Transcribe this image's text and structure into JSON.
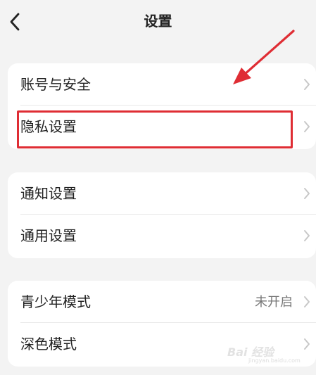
{
  "header": {
    "title": "设置"
  },
  "sections": [
    {
      "items": [
        {
          "label": "账号与安全"
        },
        {
          "label": "隐私设置"
        }
      ]
    },
    {
      "items": [
        {
          "label": "通知设置"
        },
        {
          "label": "通用设置"
        }
      ]
    },
    {
      "items": [
        {
          "label": "青少年模式",
          "value": "未开启"
        },
        {
          "label": "深色模式"
        }
      ]
    }
  ],
  "annotation": {
    "highlight_color": "#df2d34"
  },
  "watermark": {
    "text": "Bai 经验",
    "sub": "jingyan.baidu.com"
  }
}
